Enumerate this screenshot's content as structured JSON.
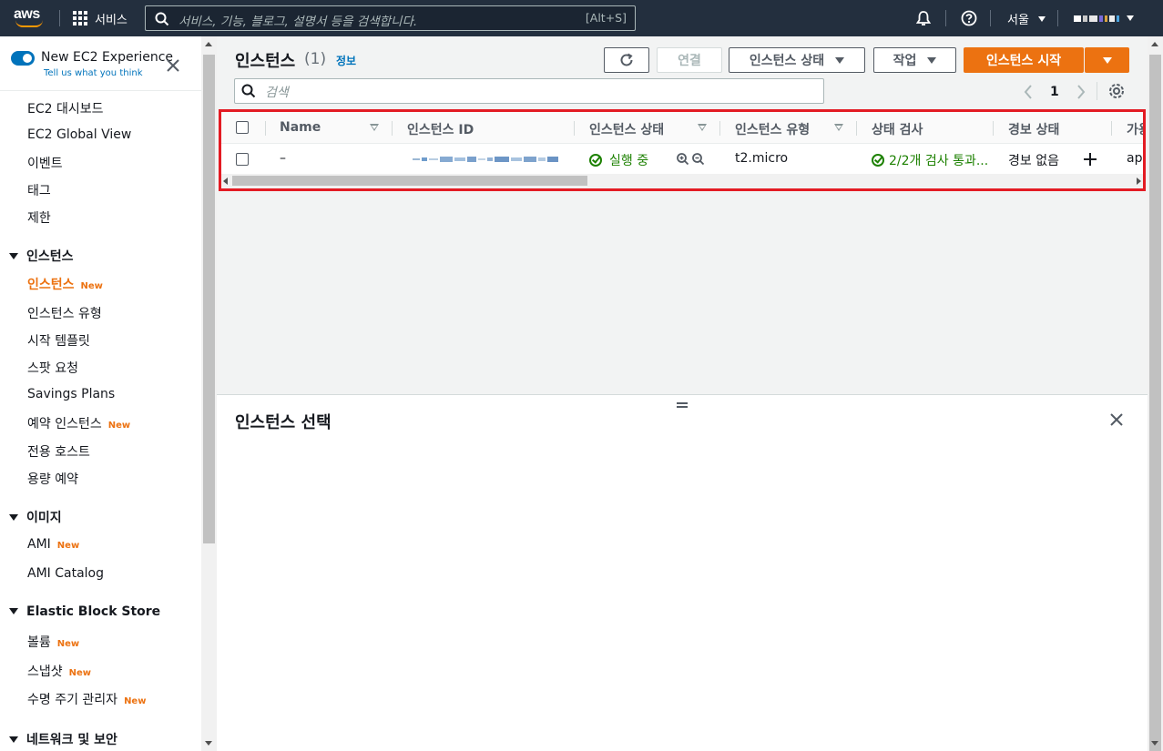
{
  "topnav": {
    "logo_text": "aws",
    "services_label": "서비스",
    "search_placeholder": "서비스, 기능, 블로그, 설명서 등을 검색합니다.",
    "search_shortcut": "[Alt+S]",
    "region_label": "서울",
    "icons": [
      "grid-icon",
      "search-icon",
      "bell-icon",
      "help-icon",
      "caret-down-icon"
    ]
  },
  "sidebar": {
    "experience_title": "New EC2 Experience",
    "experience_link": "Tell us what you think",
    "top_items": [
      "EC2 대시보드",
      "EC2 Global View",
      "이벤트",
      "태그",
      "제한"
    ],
    "sections": [
      {
        "title": "인스턴스",
        "items": [
          {
            "label": "인스턴스",
            "badge": "New",
            "active": true
          },
          {
            "label": "인스턴스 유형",
            "badge": "",
            "active": false
          },
          {
            "label": "시작 템플릿",
            "badge": "",
            "active": false
          },
          {
            "label": "스팟 요청",
            "badge": "",
            "active": false
          },
          {
            "label": "Savings Plans",
            "badge": "",
            "active": false
          },
          {
            "label": "예약 인스턴스",
            "badge": "New",
            "active": false
          },
          {
            "label": "전용 호스트",
            "badge": "",
            "active": false
          },
          {
            "label": "용량 예약",
            "badge": "",
            "active": false
          }
        ]
      },
      {
        "title": "이미지",
        "items": [
          {
            "label": "AMI",
            "badge": "New",
            "active": false
          },
          {
            "label": "AMI Catalog",
            "badge": "",
            "active": false
          }
        ]
      },
      {
        "title": "Elastic Block Store",
        "items": [
          {
            "label": "볼륨",
            "badge": "New",
            "active": false
          },
          {
            "label": "스냅샷",
            "badge": "New",
            "active": false
          },
          {
            "label": "수명 주기 관리자",
            "badge": "New",
            "active": false
          }
        ]
      },
      {
        "title": "네트워크 및 보안",
        "items": []
      }
    ]
  },
  "main": {
    "title": "인스턴스",
    "count": "(1)",
    "info_link": "정보",
    "buttons": {
      "connect": "연결",
      "instance_state": "인스턴스 상태",
      "actions": "작업",
      "launch": "인스턴스 시작"
    },
    "search_placeholder": "검색",
    "page_number": "1",
    "table": {
      "columns": [
        "Name",
        "인스턴스 ID",
        "인스턴스 상태",
        "인스턴스 유형",
        "상태 검사",
        "경보 상태",
        "가용"
      ],
      "rows": [
        {
          "name": "–",
          "instance_id": "",
          "state": "실행 중",
          "type": "t2.micro",
          "status_check": "2/2개 검사 통과...",
          "alarm": "경보 없음",
          "az": "ap-"
        }
      ]
    }
  },
  "split_panel": {
    "title": "인스턴스 선택"
  },
  "colors": {
    "nav_bg": "#232f3e",
    "accent_orange": "#ec7211",
    "link_blue": "#0073bb",
    "success_green": "#1d8102",
    "highlight_red": "#e31b23"
  }
}
